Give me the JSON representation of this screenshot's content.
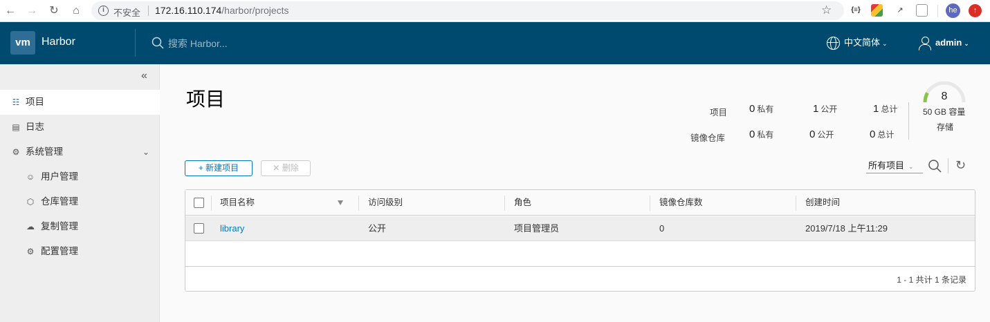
{
  "browser": {
    "insecure_label": "不安全",
    "url_host": "172.16.110.174",
    "url_path": "/harbor/projects",
    "ext_json": "{≡}",
    "profile_initials": "he"
  },
  "header": {
    "logo_text": "vm",
    "brand": "Harbor",
    "search_placeholder": "搜索 Harbor...",
    "language": "中文简体",
    "user": "admin"
  },
  "sidebar": {
    "items": [
      {
        "label": "项目",
        "icon": "projects-icon"
      },
      {
        "label": "日志",
        "icon": "logs-icon"
      },
      {
        "label": "系统管理",
        "icon": "admin-icon"
      },
      {
        "label": "用户管理",
        "icon": "users-icon"
      },
      {
        "label": "仓库管理",
        "icon": "registry-icon"
      },
      {
        "label": "复制管理",
        "icon": "replication-icon"
      },
      {
        "label": "配置管理",
        "icon": "config-icon"
      }
    ]
  },
  "main": {
    "title": "项目",
    "stats": {
      "projects_label": "项目",
      "repos_label": "镜像仓库",
      "private_label": "私有",
      "public_label": "公开",
      "total_label": "总计",
      "projects_private": "0",
      "projects_public": "1",
      "projects_total": "1",
      "repos_private": "0",
      "repos_public": "0",
      "repos_total": "0"
    },
    "storage": {
      "count": "8",
      "capacity": "50 GB 容量",
      "label": "存储",
      "used_fraction": 0.16
    },
    "toolbar": {
      "new_project": "新建项目",
      "delete": "删除",
      "filter_value": "所有项目"
    },
    "table": {
      "columns": [
        "项目名称",
        "访问级别",
        "角色",
        "镜像仓库数",
        "创建时间"
      ],
      "rows": [
        {
          "name": "library",
          "access": "公开",
          "role": "项目管理员",
          "repo_count": "0",
          "created": "2019/7/18 上午11:29"
        }
      ],
      "footer": "1 - 1 共计 1 条记录"
    }
  }
}
